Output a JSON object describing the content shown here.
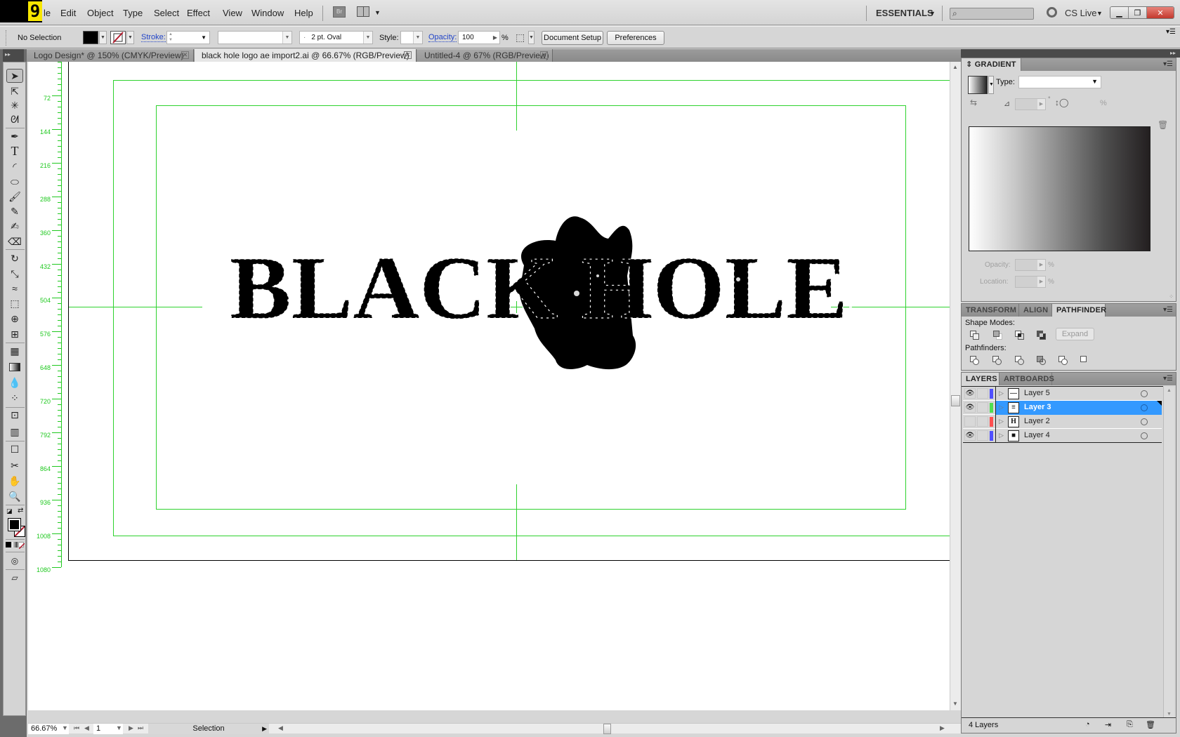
{
  "menubar": {
    "app_badge": "9",
    "items": [
      "le",
      "Edit",
      "Object",
      "Type",
      "Select",
      "Effect",
      "View",
      "Window",
      "Help"
    ],
    "bridge_label": "Br",
    "workspace": "ESSENTIALS",
    "search_placeholder": "",
    "cs_live": "CS Live"
  },
  "controlbar": {
    "selection_status": "No Selection",
    "stroke_label": "Stroke:",
    "stroke_weight": "",
    "variable_width": "",
    "brush": "2 pt. Oval",
    "style_label": "Style:",
    "opacity_label": "Opacity:",
    "opacity_value": "100",
    "percent": "%",
    "document_setup": "Document Setup",
    "preferences": "Preferences",
    "colors": {
      "fill": "#000000",
      "stroke_none": "#b2182b",
      "link_blue": "#2245c8"
    }
  },
  "tabs": [
    {
      "label": "Logo Design* @ 150% (CMYK/Preview)",
      "active": false
    },
    {
      "label": "black hole logo ae import2.ai @ 66.67% (RGB/Preview)",
      "active": true
    },
    {
      "label": "Untitled-4 @ 67% (RGB/Preview)",
      "active": false
    }
  ],
  "tools": [
    "selection-tool",
    "direct-selection-tool",
    "magic-wand-tool",
    "lasso-tool",
    "pen-tool",
    "type-tool",
    "arc-tool",
    "ellipse-tool",
    "paintbrush-tool",
    "pencil-tool",
    "blob-brush-tool",
    "eraser-tool",
    "rotate-tool",
    "scale-tool",
    "warp-tool",
    "free-transform-tool",
    "shape-builder-tool",
    "perspective-grid-tool",
    "mesh-tool",
    "gradient-tool",
    "eyedropper-tool",
    "blend-tool",
    "symbol-sprayer-tool",
    "column-graph-tool",
    "artboard-tool",
    "slice-tool",
    "hand-tool",
    "zoom-tool"
  ],
  "ruler": {
    "labels": [
      "72",
      "144",
      "216",
      "288",
      "360",
      "432",
      "504",
      "576",
      "648",
      "720",
      "792",
      "864",
      "936",
      "1008",
      "1080"
    ],
    "color": "#1ec81e"
  },
  "canvas": {
    "logo_text": "BLACK HOLE",
    "guide_color": "#2ed22e"
  },
  "statusbar": {
    "zoom": "66.67%",
    "artboard": "1",
    "tool": "Selection"
  },
  "panels": {
    "gradient": {
      "title": "GRADIENT",
      "type_label": "Type:",
      "type_value": "",
      "angle_value": "",
      "degree": "°",
      "aspect_percent": "%",
      "opacity_label": "Opacity:",
      "location_label": "Location:",
      "percent": "%"
    },
    "pathfinder_group": {
      "tabs": [
        "TRANSFORM",
        "ALIGN",
        "PATHFINDER"
      ],
      "active_tab": "PATHFINDER",
      "shape_modes_label": "Shape Modes:",
      "shape_modes": [
        "unite",
        "minus-front",
        "intersect",
        "exclude"
      ],
      "expand_label": "Expand",
      "pathfinders_label": "Pathfinders:",
      "pathfinders": [
        "divide",
        "trim",
        "merge",
        "crop",
        "outline",
        "minus-back"
      ]
    },
    "layers": {
      "tabs": [
        "LAYERS",
        "ARTBOARDS"
      ],
      "active_tab": "LAYERS",
      "rows": [
        {
          "name": "Layer 5",
          "visible": true,
          "color": "#4f4fff",
          "thumb": "—",
          "selected": false
        },
        {
          "name": "Layer 3",
          "visible": true,
          "color": "#4fdf4f",
          "thumb": "≡",
          "selected": true
        },
        {
          "name": "Layer 2",
          "visible": false,
          "color": "#ff4f4f",
          "thumb": "H",
          "selected": false
        },
        {
          "name": "Layer 4",
          "visible": true,
          "color": "#4f4fff",
          "thumb": "■",
          "selected": false
        }
      ],
      "count_label": "4 Layers"
    }
  }
}
